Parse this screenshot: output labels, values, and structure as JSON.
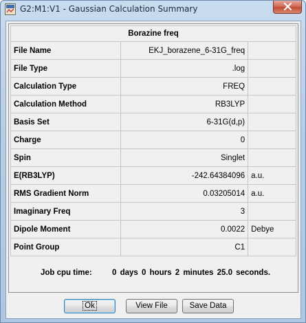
{
  "window": {
    "title": "G2:M1:V1 - Gaussian Calculation Summary"
  },
  "summary": {
    "header": "Borazine freq",
    "rows": [
      {
        "label": "File Name",
        "value": "EKJ_borazene_6-31G_freq",
        "unit": ""
      },
      {
        "label": "File Type",
        "value": ".log",
        "unit": ""
      },
      {
        "label": "Calculation Type",
        "value": "FREQ",
        "unit": ""
      },
      {
        "label": "Calculation Method",
        "value": "RB3LYP",
        "unit": ""
      },
      {
        "label": "Basis Set",
        "value": "6-31G(d,p)",
        "unit": ""
      },
      {
        "label": "Charge",
        "value": "0",
        "unit": ""
      },
      {
        "label": "Spin",
        "value": "Singlet",
        "unit": ""
      },
      {
        "label": "E(RB3LYP)",
        "value": "-242.64384096",
        "unit": "a.u."
      },
      {
        "label": "RMS Gradient Norm",
        "value": "0.03205014",
        "unit": "a.u."
      },
      {
        "label": "Imaginary Freq",
        "value": "3",
        "unit": ""
      },
      {
        "label": "Dipole Moment",
        "value": "0.0022",
        "unit": "Debye"
      },
      {
        "label": "Point Group",
        "value": "C1",
        "unit": ""
      }
    ],
    "cpu_label": "Job cpu time:",
    "cpu_value": "0 days  0 hours  2 minutes  25.0 seconds."
  },
  "buttons": {
    "ok": "Ok",
    "view_file": "View File",
    "save_data": "Save Data"
  }
}
